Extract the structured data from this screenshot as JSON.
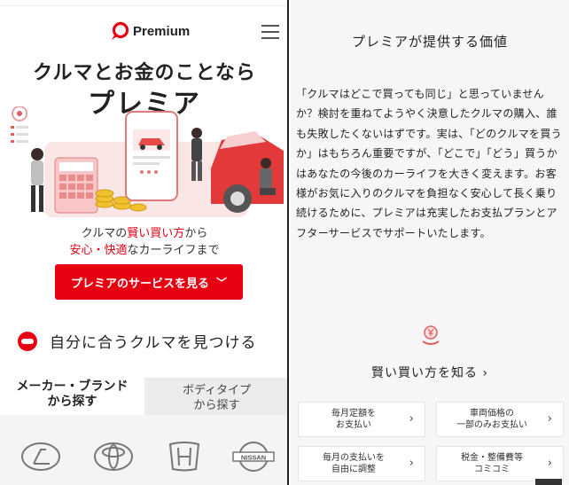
{
  "header": {
    "logo_text": "Premium",
    "menu_icon": "hamburger-menu-icon"
  },
  "hero": {
    "title_line1": "クルマとお金のことなら",
    "title_line2": "プレミア",
    "tagline_pre1": "クルマの",
    "tagline_red1": "賢い買い方",
    "tagline_post1": "から",
    "tagline_red2": "安心・快適",
    "tagline_post2": "なカーライフまで"
  },
  "cta": {
    "label": "プレミアのサービスを見る",
    "chevron": "﹀"
  },
  "find": {
    "label": "自分に合うクルマを見つける"
  },
  "tabs": [
    {
      "line1": "メーカー・ブランド",
      "line2": "から探す",
      "active": true
    },
    {
      "line1": "ボディタイプ",
      "line2": "から探す",
      "active": false
    }
  ],
  "brands": [
    {
      "name": "lexus-logo"
    },
    {
      "name": "toyota-logo"
    },
    {
      "name": "honda-logo"
    },
    {
      "name": "nissan-logo",
      "text": "NISSAN"
    }
  ],
  "value_section": {
    "title": "プレミアが提供する価値",
    "body": "「クルマはどこで買っても同じ」と思っていませんか？検討を重ねてようやく決意したクルマの購入、誰も失敗したくないはずです。実は、「どのクルマを買うか」はもちろん重要ですが、「どこで」「どう」買うかはあなたの今後のカーライフを大きく変えます。お客様がお気に入りのクルマを負担なく安心して長く乗り続けるために、プレミアは充実したお支払プランとアフターサービスでサポートいたします。",
    "learn_link": "賢い買い方を知る ›"
  },
  "cards": [
    {
      "line1": "毎月定額を",
      "line2": "お支払い",
      "arrow": "›"
    },
    {
      "line1": "車両価格の",
      "line2": "一部のみお支払い",
      "arrow": "›"
    },
    {
      "line1": "毎月の支払いを",
      "line2": "自由に調整",
      "arrow": "›"
    },
    {
      "line1": "税金・整備費等",
      "line2": "コミコミ",
      "arrow": "›"
    }
  ],
  "colors": {
    "brand_red": "#e60012",
    "tab_inactive_bg": "#ececec",
    "right_bg": "#f6f6f6"
  }
}
